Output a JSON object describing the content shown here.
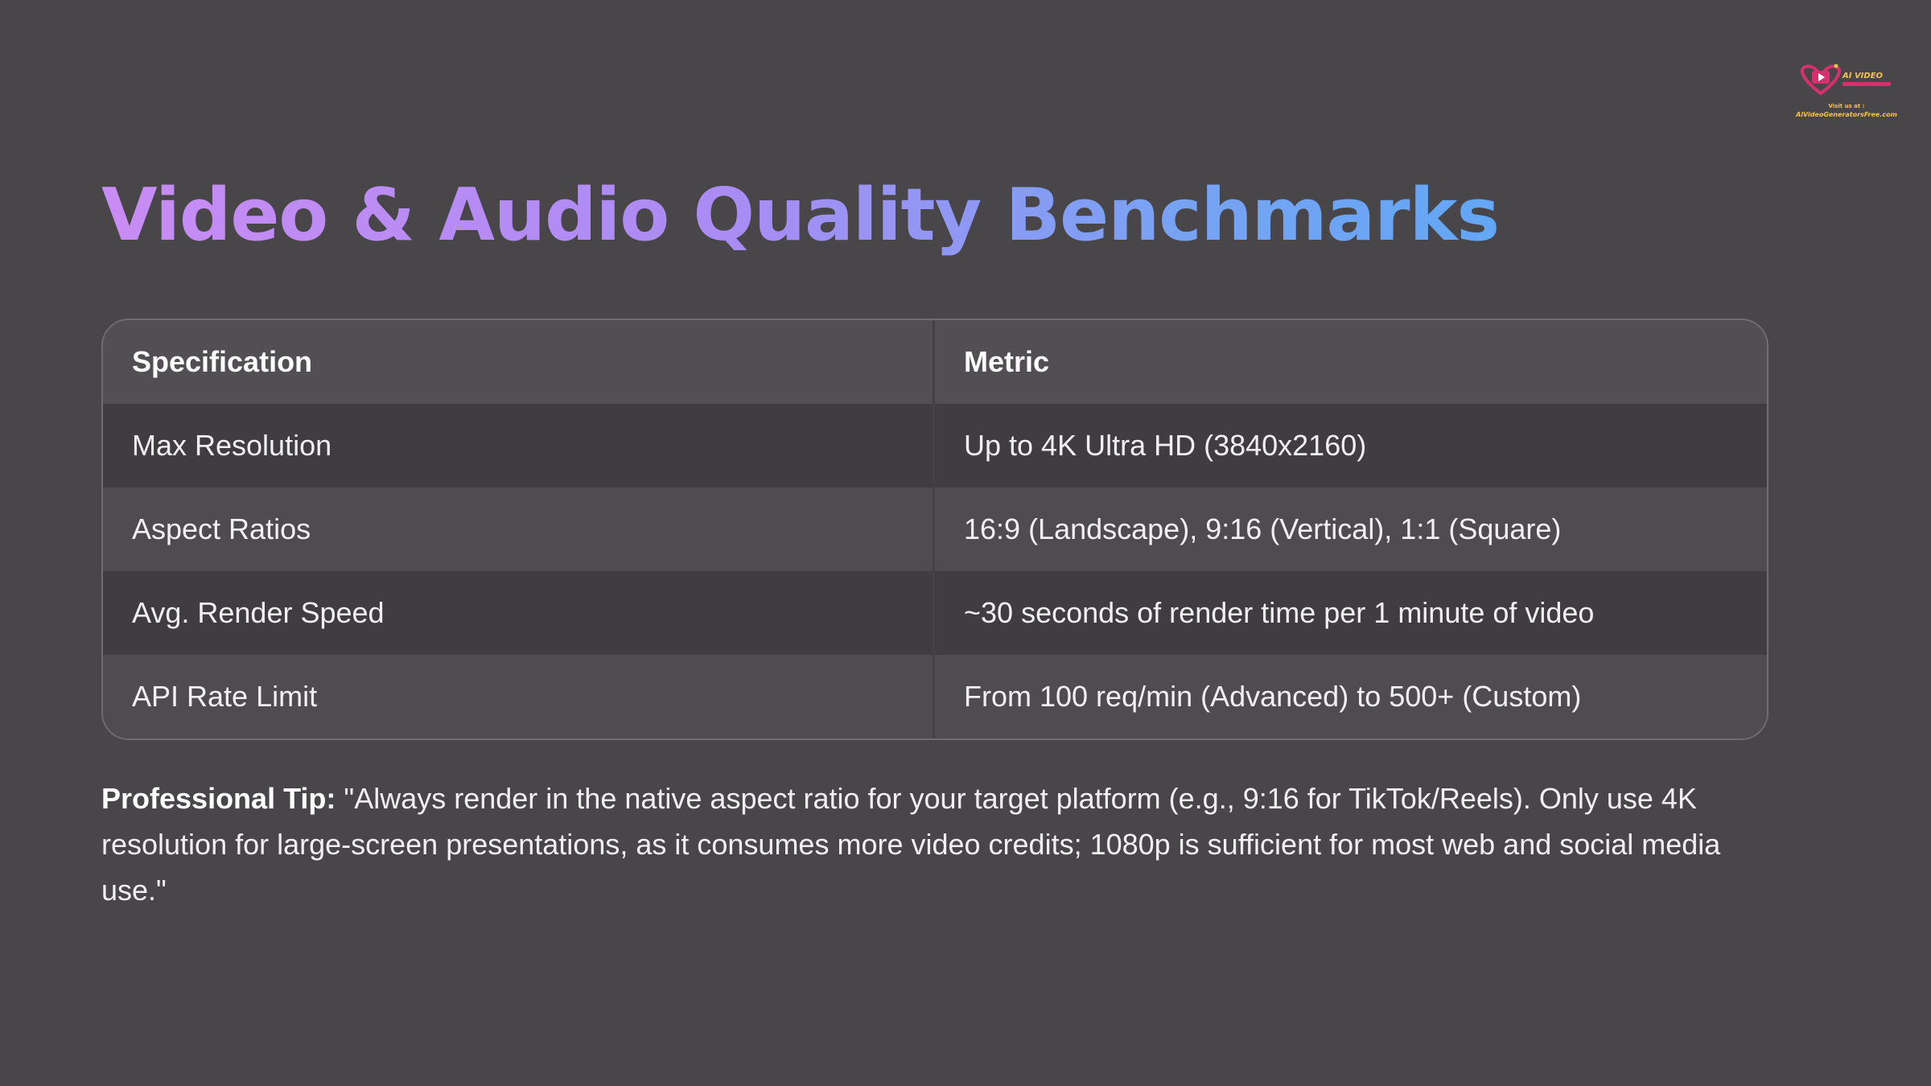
{
  "logo": {
    "brand_text": "AI VIDEO",
    "visit_text": "Visit us at :",
    "url_text": "AiVideoGeneratorsFree.com",
    "colors": {
      "pink": "#d8306e",
      "gold": "#f3c24a"
    },
    "icon": "play-heart-logo-icon"
  },
  "title": "Video & Audio Quality Benchmarks",
  "table": {
    "headers": [
      "Specification",
      "Metric"
    ],
    "rows": [
      [
        "Max Resolution",
        "Up to 4K Ultra HD (3840x2160)"
      ],
      [
        "Aspect Ratios",
        "16:9 (Landscape), 9:16 (Vertical), 1:1 (Square)"
      ],
      [
        "Avg. Render Speed",
        "~30 seconds of render time per 1 minute of video"
      ],
      [
        "API Rate Limit",
        "From 100 req/min (Advanced) to 500+ (Custom)"
      ]
    ]
  },
  "tip": {
    "label": "Professional Tip:",
    "text": " \"Always render in the native aspect ratio for your target platform (e.g., 9:16 for TikTok/Reels). Only use 4K resolution for large-screen presentations, as it consumes more video credits; 1080p is sufficient for most web and social media use.\""
  },
  "colors": {
    "background": "#484648",
    "title_gradient_start": "#c98cf4",
    "title_gradient_end": "#62a7f5"
  }
}
